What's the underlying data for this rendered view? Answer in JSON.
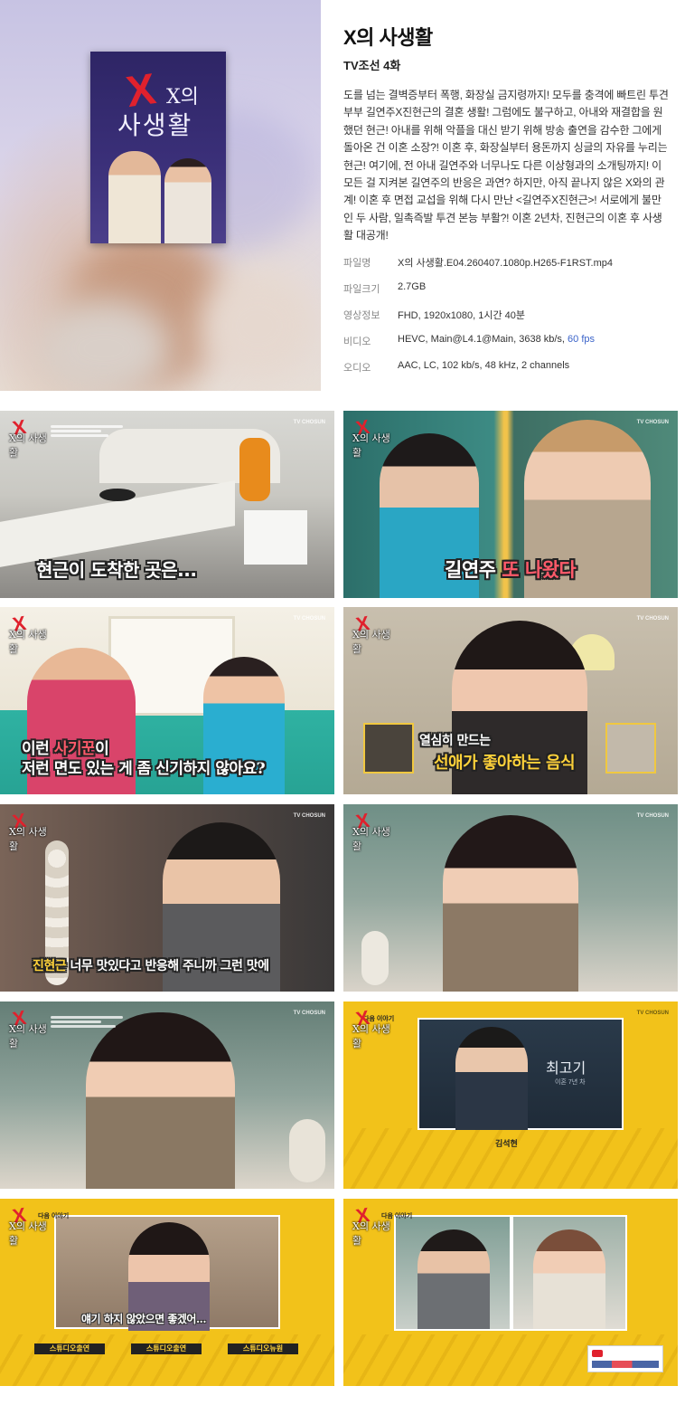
{
  "show": {
    "title": "X의 사생활",
    "channel_episode": "TV조선  4화",
    "description": "도를 넘는 결벽증부터 폭행, 화장실 금지령까지! 모두를 충격에 빠트린 투견부부 길연주X진현근의 결혼 생활! 그럼에도 불구하고, 아내와 재결합을 원했던 현근! 아내를 위해 악플을 대신 받기 위해 방송 출연을 감수한 그에게 돌아온 건 이혼 소장?! 이혼 후, 화장실부터 용돈까지 싱글의 자유를 누리는 현근! 여기에, 전 아내 길연주와 너무나도 다른 이상형과의 소개팅까지! 이 모든 걸 지켜본 길연주의 반응은 과연? 하지만, 아직 끝나지 않은 X와의 관계! 이혼 후 면접 교섭을 위해 다시 만난 <길연주X진현근>! 서로에게 불만인 두 사람, 일촉즉발 투견 본능 부활?! 이혼 2년차, 진현근의 이혼 후 사생활 대공개!",
    "poster_title_line1": "X의",
    "poster_title_line2": "사생활"
  },
  "file_info": {
    "filename_label": "파일명",
    "filename": "X의 사생활.E04.260407.1080p.H265-F1RST.mp4",
    "size_label": "파일크기",
    "size": "2.7GB",
    "video_info_label": "영상정보",
    "video_info": "FHD, 1920x1080, 1시간 40분",
    "video_label": "비디오",
    "video_codec": "HEVC, Main@L4.1@Main, 3638 kb/s,",
    "video_fps": "60 fps",
    "audio_label": "오디오",
    "audio": "AAC, LC, 102 kb/s, 48 kHz, 2 channels"
  },
  "colors": {
    "poster_bg": "#2e2565",
    "logo_red": "#e0212d",
    "fps_blue": "#3a63c9",
    "next_yellow": "#f2c21a"
  },
  "screenshots": {
    "logo_text": "X의 사생활",
    "brand": "TV CHOSUN",
    "s1_caption": "현근이 도착한 곳은...",
    "s2_caption_name": "길연주",
    "s2_caption_rest": " 또 나왔다",
    "s3_line1_pre": "이런 ",
    "s3_line1_acc": "사기꾼",
    "s3_line1_post": "이",
    "s3_line2": "저런 면도 있는 게 좀 신기하지 않아요?",
    "s4_line1": "열심히 만드는",
    "s4_line2": "선애가 좋아하는 음식",
    "s5_name": "진현근",
    "s5_text": " 너무 맛있다고 반응해 주니까 그런 맛에",
    "s10_next": "다음 이야기",
    "s10_card": "최고기",
    "s10_card_sub": "이혼 7년 차",
    "s10_name": "김석현",
    "s11_next": "다음 이야기",
    "s11_caption": "얘기 하지 않았으면 좋겠어...",
    "s11_badge1": "스튜디오출연",
    "s11_badge2": "스튜디오출연",
    "s11_badge3": "스튜디오뉴원",
    "s12_next": "다음 이야기"
  }
}
